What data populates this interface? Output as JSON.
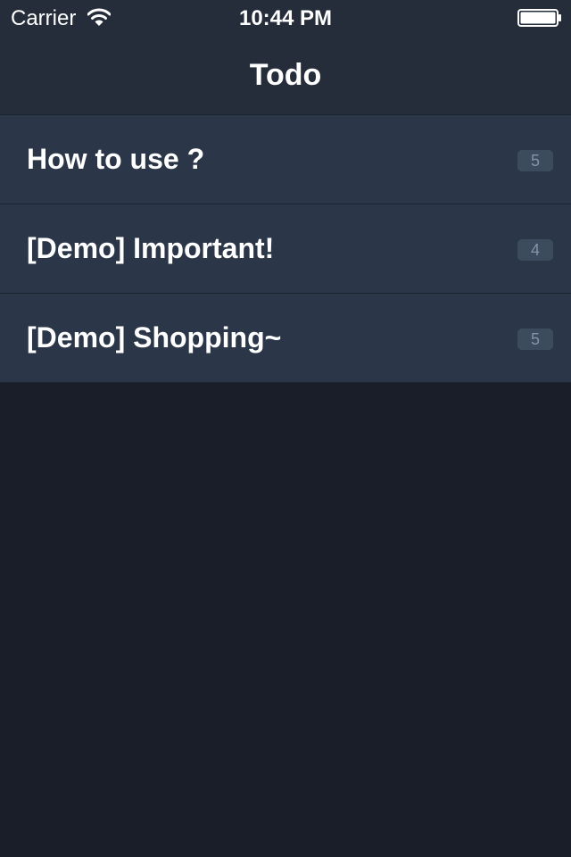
{
  "status_bar": {
    "carrier": "Carrier",
    "wifi_icon": "wifi-icon",
    "time": "10:44 PM",
    "battery_icon": "battery-full-icon"
  },
  "nav": {
    "title": "Todo"
  },
  "lists": [
    {
      "title": "How to use ?",
      "count": "5"
    },
    {
      "title": "[Demo] Important!",
      "count": "4"
    },
    {
      "title": "[Demo] Shopping~",
      "count": "5"
    }
  ],
  "colors": {
    "header_bg": "#252d3b",
    "row_bg": "#2b3748",
    "page_bg": "#1a1e29",
    "badge_bg": "#3d4b5e",
    "badge_text": "#8593a7"
  }
}
